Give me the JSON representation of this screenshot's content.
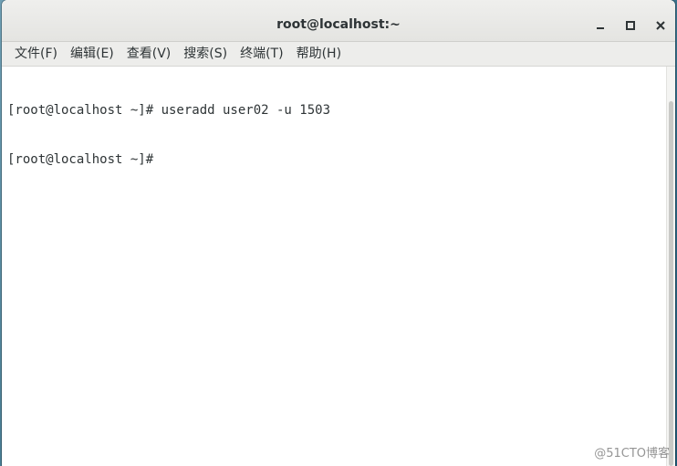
{
  "window": {
    "title": "root@localhost:~"
  },
  "menu": {
    "items": [
      {
        "label": "文件(F)"
      },
      {
        "label": "编辑(E)"
      },
      {
        "label": "查看(V)"
      },
      {
        "label": "搜索(S)"
      },
      {
        "label": "终端(T)"
      },
      {
        "label": "帮助(H)"
      }
    ]
  },
  "terminal": {
    "lines": [
      "[root@localhost ~]# useradd user02 -u 1503",
      "[root@localhost ~]#"
    ]
  },
  "watermark": "@51CTO博客",
  "icons": {
    "minimize": "minimize-icon",
    "maximize": "maximize-icon",
    "close": "close-icon"
  },
  "colors": {
    "titlebar": "#e9e9e7",
    "text": "#2e3436",
    "desktop": "#3f7a95"
  }
}
